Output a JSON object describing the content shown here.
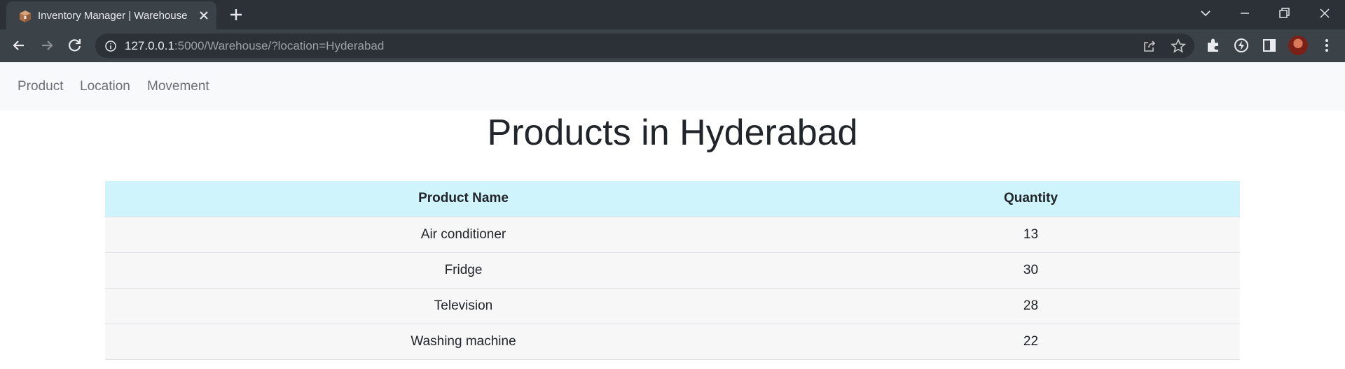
{
  "browser": {
    "tab_title": "Inventory Manager | Warehouse",
    "url_host": "127.0.0.1",
    "url_rest": ":5000/Warehouse/?location=Hyderabad"
  },
  "nav": {
    "items": [
      {
        "label": "Product"
      },
      {
        "label": "Location"
      },
      {
        "label": "Movement"
      }
    ]
  },
  "page": {
    "title": "Products in Hyderabad"
  },
  "table": {
    "headers": [
      "Product Name",
      "Quantity"
    ],
    "rows": [
      {
        "name": "Air conditioner",
        "quantity": "13"
      },
      {
        "name": "Fridge",
        "quantity": "30"
      },
      {
        "name": "Television",
        "quantity": "28"
      },
      {
        "name": "Washing machine",
        "quantity": "22"
      }
    ]
  },
  "colors": {
    "header_row": "#cff4fc",
    "navbar": "#f8f9fa",
    "browser_frame": "#3b4248"
  }
}
